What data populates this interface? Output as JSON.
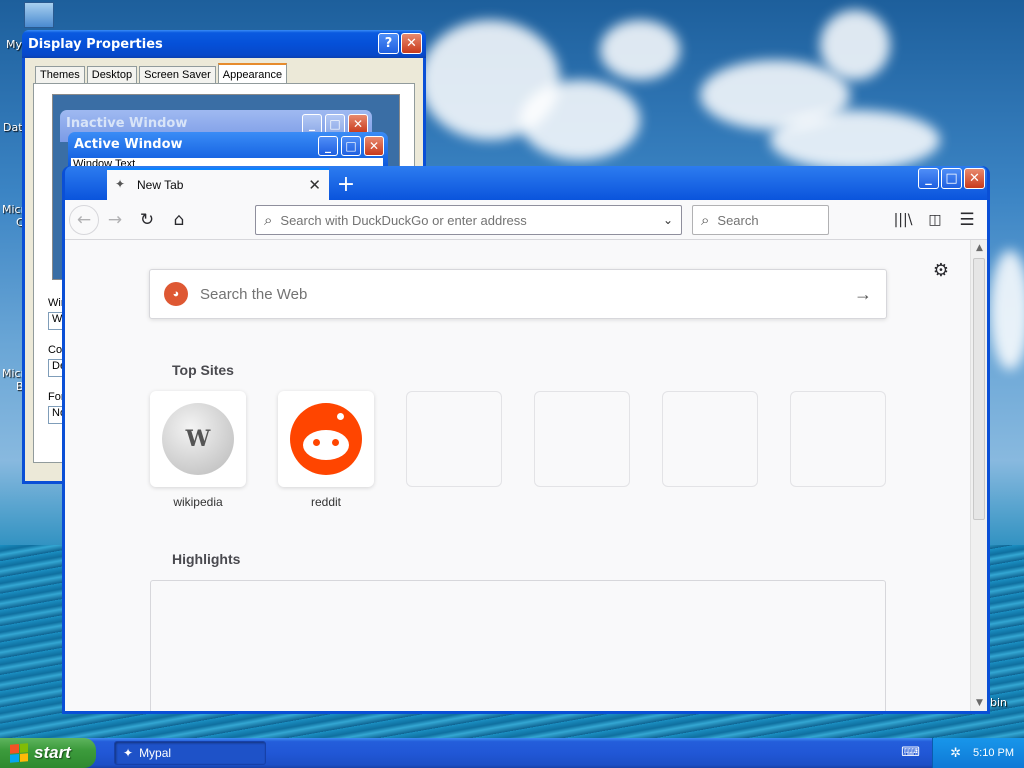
{
  "desktop": {
    "icons": [
      {
        "label": "My",
        "icon": "computer-icon"
      },
      {
        "label": "Dat",
        "icon": "folder-icon"
      },
      {
        "label": "Micr",
        "icon": "app-icon"
      },
      {
        "label": "C",
        "icon": "app-icon"
      },
      {
        "label": "Micr",
        "icon": "app-icon"
      },
      {
        "label": "B",
        "icon": "app-icon"
      },
      {
        "label": "bin",
        "icon": "recycle-bin-icon"
      }
    ]
  },
  "display_properties": {
    "title": "Display Properties",
    "tabs": [
      "Themes",
      "Desktop",
      "Screen Saver",
      "Appearance"
    ],
    "active_tab": "Appearance",
    "preview": {
      "inactive_title": "Inactive Window",
      "active_title": "Active Window",
      "window_text": "Window Text"
    },
    "labels": {
      "windows": "Win",
      "color": "Col",
      "font": "For"
    },
    "fields": {
      "windows": "W",
      "color": "De",
      "font": "No"
    }
  },
  "browser": {
    "tab_title": "New Tab",
    "new_tab_symbol": "+",
    "url_placeholder": "Search with DuckDuckGo or enter address",
    "search_placeholder": "Search",
    "web_search_placeholder": "Search the Web",
    "top_sites_title": "Top Sites",
    "highlights_title": "Highlights",
    "top_sites": [
      {
        "label": "wikipedia",
        "icon": "wikipedia-icon"
      },
      {
        "label": "reddit",
        "icon": "reddit-icon"
      },
      {
        "label": "",
        "icon": ""
      },
      {
        "label": "",
        "icon": ""
      },
      {
        "label": "",
        "icon": ""
      },
      {
        "label": "",
        "icon": ""
      }
    ]
  },
  "taskbar": {
    "start_label": "start",
    "task_label": "Mypal",
    "clock": "5:10 PM"
  },
  "colors": {
    "xp_blue": "#0550d8",
    "accent": "#0a84ff",
    "ddg_orange": "#de5833",
    "reddit_orange": "#ff4500"
  }
}
